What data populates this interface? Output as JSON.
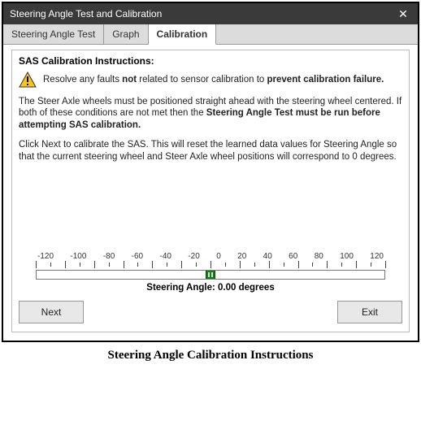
{
  "window": {
    "title": "Steering Angle Test and Calibration",
    "close": "✕"
  },
  "tabs": {
    "test": "Steering Angle Test",
    "graph": "Graph",
    "calibration": "Calibration"
  },
  "heading": "SAS Calibration Instructions:",
  "warning": {
    "pre": "Resolve any faults ",
    "bold1": "not",
    "mid": " related to sensor calibration to ",
    "bold2": "prevent calibration failure."
  },
  "para1": {
    "pre": "The Steer Axle wheels must be positioned straight ahead with the steering wheel centered. If both of these conditions are not met then the ",
    "bold": "Steering Angle Test must be run before attempting SAS calibration."
  },
  "para2": "Click Next to calibrate the SAS. This will reset the learned data values for Steering Angle so that the current steering wheel and Steer Axle wheel positions will correspond to 0 degrees.",
  "scale": {
    "labels": [
      "-120",
      "-100",
      "-80",
      "-60",
      "-40",
      "-20",
      "0",
      "20",
      "40",
      "60",
      "80",
      "100",
      "120"
    ],
    "readout_label": "Steering Angle: ",
    "readout_value": "0.00 degrees",
    "indicator_percent": 50
  },
  "buttons": {
    "next": "Next",
    "exit": "Exit"
  },
  "caption": "Steering Angle Calibration Instructions"
}
